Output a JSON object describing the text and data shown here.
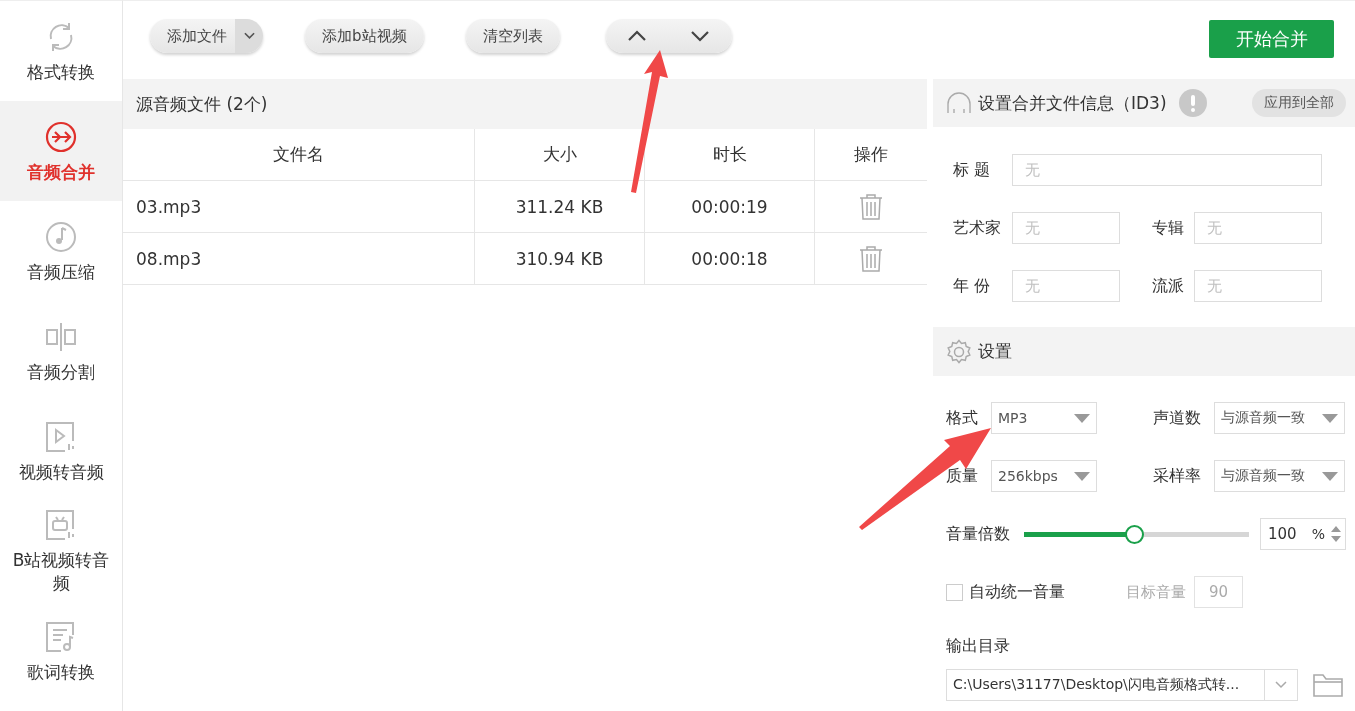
{
  "sidebar": {
    "items": [
      {
        "label": "格式转换",
        "kind": "convert",
        "selected": false
      },
      {
        "label": "音频合并",
        "kind": "merge",
        "selected": true
      },
      {
        "label": "音频压缩",
        "kind": "compress",
        "selected": false
      },
      {
        "label": "音频分割",
        "kind": "split",
        "selected": false
      },
      {
        "label": "视频转音频",
        "kind": "video",
        "selected": false
      },
      {
        "label": "B站视频转音频",
        "kind": "bili",
        "selected": false
      },
      {
        "label": "歌词转换",
        "kind": "lyrics",
        "selected": false
      }
    ]
  },
  "toolbar": {
    "buttons": [
      {
        "label": "添加文件",
        "kind": "dropdown"
      },
      {
        "label": "添加b站视频",
        "kind": "plain"
      },
      {
        "label": "清空列表",
        "kind": "plain"
      },
      {
        "kind": "move"
      }
    ],
    "start_button": "开始合并"
  },
  "file_list": {
    "title": "源音频文件 (2个)",
    "columns": [
      "文件名",
      "大小",
      "时长",
      "操作"
    ],
    "rows": [
      [
        "03.mp3",
        "311.24 KB",
        "00:00:19"
      ],
      [
        "08.mp3",
        "310.94 KB",
        "00:00:18"
      ]
    ]
  },
  "id3": {
    "title": "设置合并文件信息（ID3)",
    "apply_button": "应用到全部",
    "fields": [
      {
        "label": "标 题",
        "placeholder": "无",
        "kind": "wide"
      },
      {
        "label": "艺术家",
        "placeholder": "无",
        "kind": "half"
      },
      {
        "label": "专辑",
        "placeholder": "无",
        "kind": "half"
      },
      {
        "label": "年 份",
        "placeholder": "无",
        "kind": "half"
      },
      {
        "label": "流派",
        "placeholder": "无",
        "kind": "half"
      }
    ]
  },
  "settings": {
    "title": "设置",
    "selects": [
      {
        "label": "格式",
        "value": "MP3"
      },
      {
        "label": "声道数",
        "value": "与源音频一致"
      },
      {
        "label": "质量",
        "value": "256kbps"
      },
      {
        "label": "采样率",
        "value": "与源音频一致"
      }
    ],
    "volume": {
      "label": "音量倍数",
      "level": 0.49,
      "value": "100",
      "unit": "%"
    },
    "auto_volume": {
      "label": "自动统一音量",
      "checked": false
    },
    "target_volume": {
      "label": "目标音量",
      "value": "90",
      "disabled": true
    },
    "output": {
      "label": "输出目录",
      "path": "C:\\Users\\31177\\Desktop\\闪电音频格式转..."
    }
  }
}
